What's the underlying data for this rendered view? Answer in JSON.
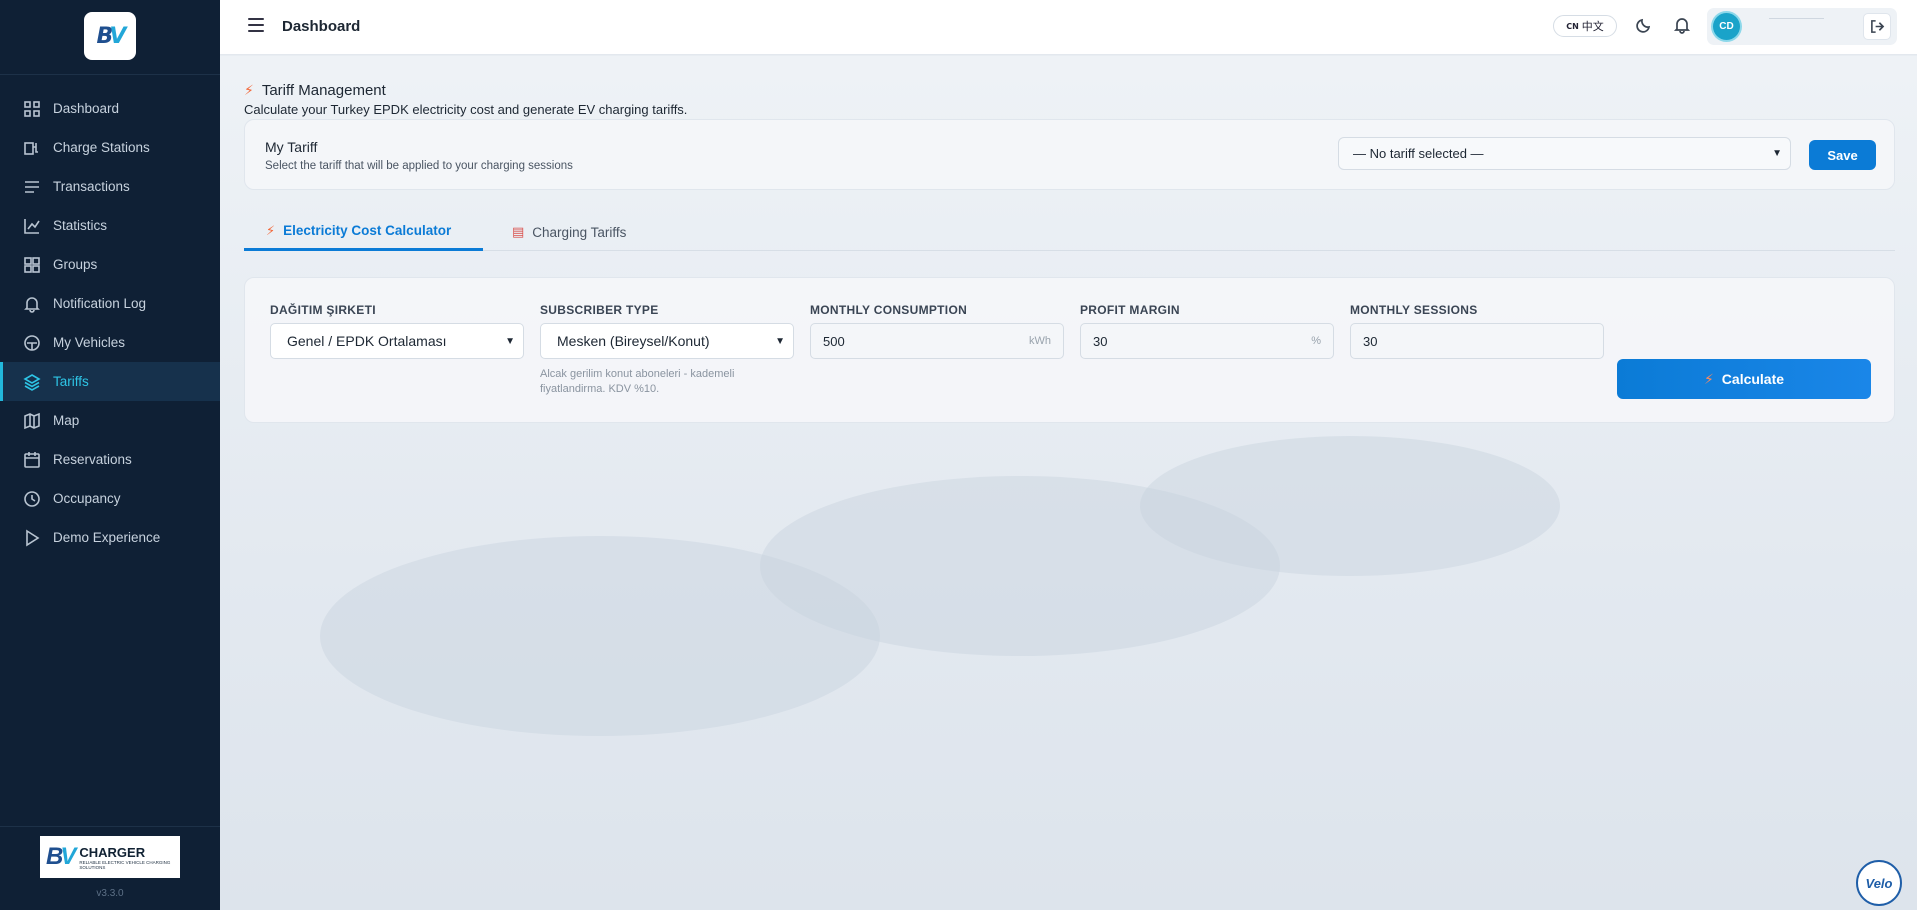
{
  "sidebar": {
    "version": "v3.3.0",
    "brand": {
      "name": "CHARGER",
      "tagline": "RELIABLE ELECTRIC VEHICLE CHARGING SOLUTIONS"
    },
    "items": [
      {
        "label": "Dashboard",
        "icon": "grid-icon"
      },
      {
        "label": "Charge Stations",
        "icon": "plug-icon"
      },
      {
        "label": "Transactions",
        "icon": "list-icon"
      },
      {
        "label": "Statistics",
        "icon": "chart-line-icon"
      },
      {
        "label": "Groups",
        "icon": "groups-grid-icon"
      },
      {
        "label": "Notification Log",
        "icon": "bell-icon"
      },
      {
        "label": "My Vehicles",
        "icon": "car-icon"
      },
      {
        "label": "Tariffs",
        "icon": "layers-icon",
        "active": true
      },
      {
        "label": "Map",
        "icon": "map-icon"
      },
      {
        "label": "Reservations",
        "icon": "calendar-icon"
      },
      {
        "label": "Occupancy",
        "icon": "clock-icon"
      },
      {
        "label": "Demo Experience",
        "icon": "play-icon"
      }
    ]
  },
  "header": {
    "title": "Dashboard",
    "lang": {
      "code": "CN",
      "label": "中文"
    },
    "avatar": "CD"
  },
  "page": {
    "title": "Tariff Management",
    "subtitle": "Calculate your Turkey EPDK electricity cost and generate EV charging tariffs."
  },
  "my_tariff": {
    "label": "My Tariff",
    "description": "Select the tariff that will be applied to your charging sessions",
    "selected": "— No tariff selected —",
    "save_label": "Save"
  },
  "tabs": [
    {
      "label": "Electricity Cost Calculator",
      "active": true
    },
    {
      "label": "Charging Tariffs",
      "active": false
    }
  ],
  "calculator": {
    "distribution": {
      "label": "DAĞITIM ŞIRKETI",
      "value": "Genel / EPDK Ortalaması"
    },
    "subscriber": {
      "label": "SUBSCRIBER TYPE",
      "value": "Mesken (Bireysel/Konut)",
      "hint": "Alcak gerilim konut aboneleri - kademeli fiyatlandirma. KDV %10."
    },
    "consumption": {
      "label": "MONTHLY CONSUMPTION",
      "value": "500",
      "unit": "kWh"
    },
    "margin": {
      "label": "PROFIT MARGIN",
      "value": "30",
      "unit": "%"
    },
    "sessions": {
      "label": "MONTHLY SESSIONS",
      "value": "30"
    },
    "button_label": "Calculate"
  },
  "badge": "Velo",
  "colors": {
    "accent": "#0b7bd6",
    "sidebar": "#0f2035",
    "active_nav": "#2ec5e6",
    "bolt": "#f26a3d"
  }
}
